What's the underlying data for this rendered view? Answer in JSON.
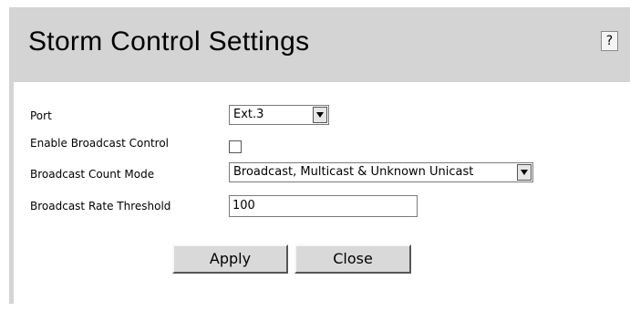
{
  "header": {
    "title": "Storm Control Settings",
    "help_label": "?"
  },
  "form": {
    "port": {
      "label": "Port",
      "value": "Ext.3"
    },
    "enable_broadcast": {
      "label": "Enable Broadcast Control",
      "checked": false
    },
    "count_mode": {
      "label": "Broadcast Count Mode",
      "value": "Broadcast, Multicast & Unknown Unicast"
    },
    "rate_threshold": {
      "label": "Broadcast Rate Threshold",
      "value": "100"
    }
  },
  "buttons": {
    "apply": "Apply",
    "close": "Close"
  }
}
